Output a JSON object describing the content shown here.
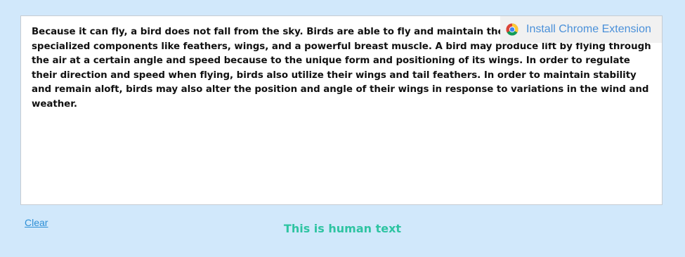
{
  "editor": {
    "text": "Because it can fly, a bird does not fall from the sky. Birds are able to fly and maintain their altitude thanks to specialized components like feathers, wings, and a powerful breast muscle. A bird may produce lift by flying through the air at a certain angle and speed because to the unique form and positioning of its wings. In order to regulate their direction and speed when flying, birds also utilize their wings and tail feathers. In order to maintain stability and remain aloft, birds may also alter the position and angle of their wings in response to variations in the wind and weather."
  },
  "banner": {
    "label": "Install Chrome Extension",
    "icon": "chrome-icon"
  },
  "actions": {
    "clear_label": "Clear"
  },
  "result": {
    "text": "This is human text"
  },
  "colors": {
    "background": "#d1e8fb",
    "link": "#2d8fd6",
    "banner_link": "#4a90d9",
    "result": "#2ec4a2"
  }
}
